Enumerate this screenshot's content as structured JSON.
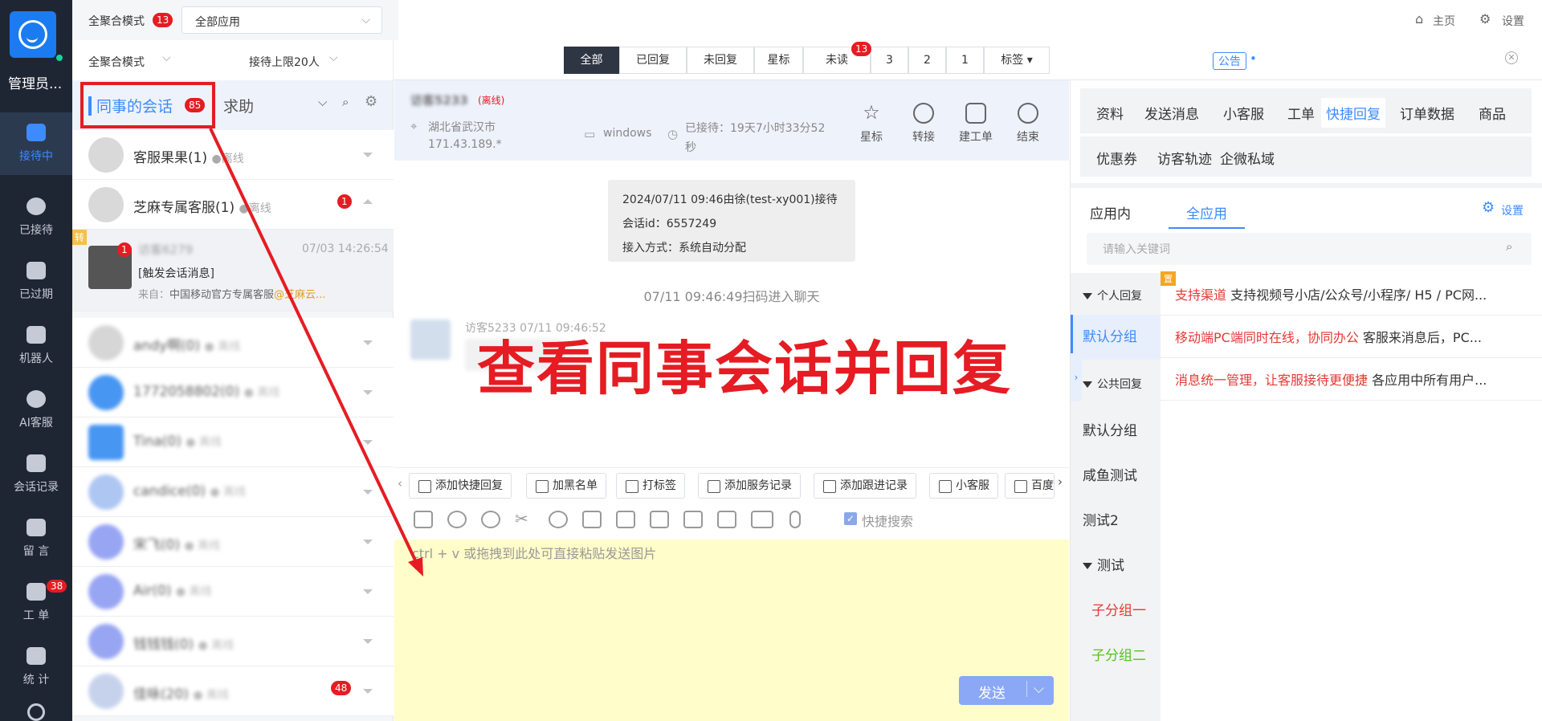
{
  "nav": {
    "user": "管理员...",
    "items": [
      {
        "label": "接待中"
      },
      {
        "label": "已接待"
      },
      {
        "label": "已过期"
      },
      {
        "label": "机器人"
      },
      {
        "label": "AI客服"
      },
      {
        "label": "会话记录"
      },
      {
        "label": "留 言"
      },
      {
        "label": "工 单",
        "badge": "38"
      },
      {
        "label": "统 计"
      }
    ]
  },
  "topbar": {
    "mode_label": "全聚合模式",
    "mode_badge": "13",
    "app_select": "全部应用",
    "home": "主页",
    "settings": "设置"
  },
  "filterbar": {
    "mode": "全聚合模式",
    "limit": "接待上限20人",
    "pills": [
      "全部",
      "已回复",
      "未回复",
      "星标",
      "未读",
      "3",
      "2",
      "1",
      "标签"
    ],
    "unread_badge": "13",
    "notice": "公告"
  },
  "sessions": {
    "tab_colleague": "同事的会话",
    "tab_colleague_badge": "85",
    "tab_help": "求助",
    "rows": [
      {
        "name": "客服果果(1)",
        "status": "●离线"
      },
      {
        "name": "芝麻专属客服(1)",
        "status": "●离线",
        "badge": "1"
      },
      {
        "transfer": "转",
        "visitor": "访客6279",
        "time": "07/03 14:26:54",
        "msg": "[触发会话消息]",
        "from_label": "来自：",
        "from": "中国移动官方专属客服",
        "from_at": "@芝麻云...",
        "avatar_badge": "1"
      },
      {
        "name": "andy啊(0)",
        "status": "● 离线"
      },
      {
        "name": "1772058802(0)",
        "status": "● 离线"
      },
      {
        "name": "Tina(0)",
        "status": "● 离线"
      },
      {
        "name": "candice(0)",
        "status": "● 离线"
      },
      {
        "name": "宋飞(0)",
        "status": "● 离线"
      },
      {
        "name": "Air(0)",
        "status": "● 离线"
      },
      {
        "name": "钱钱钱(0)",
        "status": "● 离线"
      },
      {
        "name": "佳咏(20)",
        "status": "● 离线",
        "badge": "48"
      }
    ]
  },
  "chat": {
    "visitor": "访客5233",
    "offline": "(离线)",
    "location": "湖北省武汉市",
    "ip": "171.43.189.*",
    "os": "windows",
    "waited": "已接待：19天7小时33分52秒",
    "actions": [
      "星标",
      "转接",
      "建工单",
      "结束"
    ],
    "sysmsg": [
      "2024/07/11 09:46由徐(test-xy001)接待",
      "会话id：6557249",
      "接入方式：系统自动分配"
    ],
    "scan_time": "07/11 09:46:49扫码进入聊天",
    "bubble_meta": "访客5233 07/11 09:46:52",
    "overlay": "查看同事会话并回复",
    "tools": [
      "添加快捷回复",
      "加黑名单",
      "打标签",
      "添加服务记录",
      "添加跟进记录",
      "小客服",
      "百度"
    ],
    "quick_search": "快捷搜索",
    "placeholder": "ctrl + v 或拖拽到此处可直接粘贴发送图片",
    "send": "发送"
  },
  "right": {
    "tabs1": [
      "资料",
      "发送消息",
      "小客服",
      "工单",
      "快捷回复",
      "订单数据",
      "商品"
    ],
    "tabs2": [
      "优惠券",
      "访客轨迹",
      "企微私域"
    ],
    "sub": [
      "应用内",
      "全应用"
    ],
    "settings": "设置",
    "search_placeholder": "请输入关键词",
    "groups": [
      "个人回复",
      "默认分组",
      "公共回复",
      "默认分组",
      "咸鱼测试",
      "测试2",
      "测试",
      "子分组一",
      "子分组二"
    ],
    "replies": [
      {
        "k": "支持渠道",
        "v": "支持视频号小店/公众号/小程序/ H5 / PC网..."
      },
      {
        "k": "移动端PC端同时在线，协同办公",
        "v": "客服来消息后，PC..."
      },
      {
        "k": "消息统一管理，让客服接待更便捷",
        "v": "各应用中所有用户..."
      }
    ],
    "pin": "置"
  },
  "colors": {
    "accent": "#3d8bff",
    "nav_bg": "#1f2633",
    "badge": "#e51c23",
    "highlight": "#e51c23"
  }
}
